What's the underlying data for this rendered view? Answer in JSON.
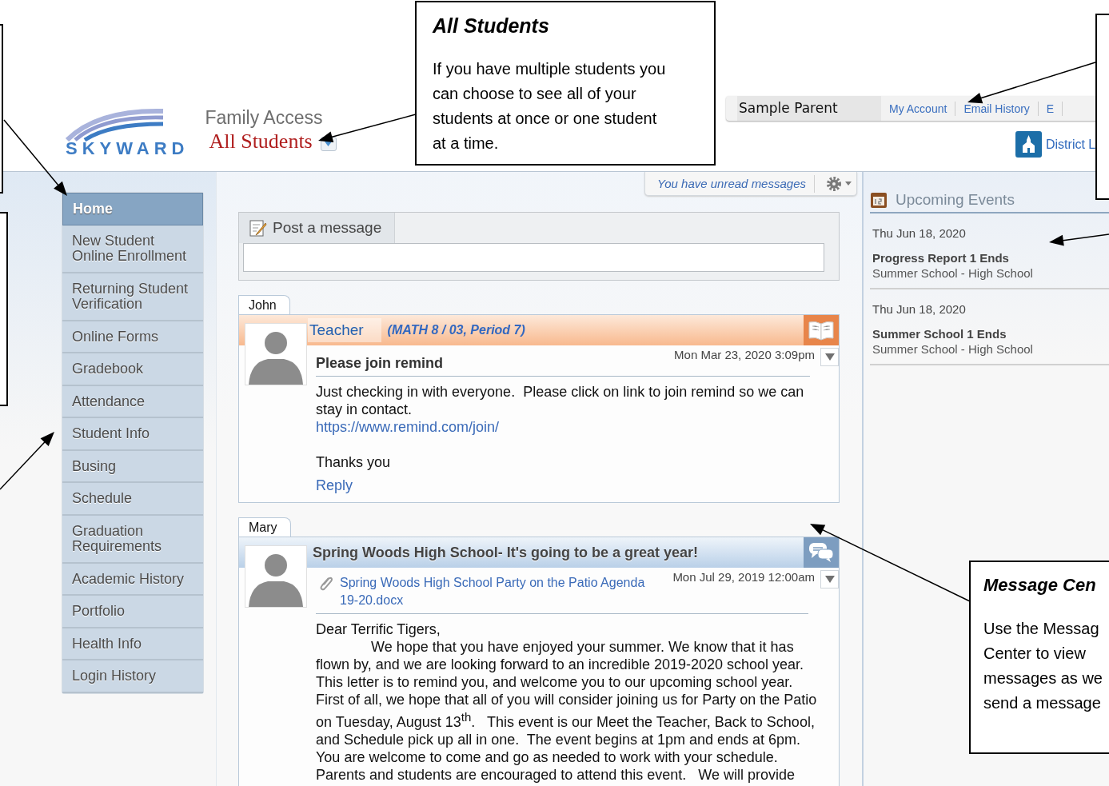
{
  "header": {
    "logo": "SKYWARD",
    "product": "Family Access",
    "student_selector": "All Students",
    "user_name": "Sample Parent",
    "links": [
      "My Account",
      "Email History",
      "E"
    ],
    "district_link": "District L"
  },
  "nav": [
    {
      "label": "Home",
      "selected": true
    },
    {
      "label": "New Student Online Enrollment",
      "selected": false
    },
    {
      "label": "Returning Student Verification",
      "selected": false
    },
    {
      "label": "Online Forms",
      "selected": false
    },
    {
      "label": "Gradebook",
      "selected": false
    },
    {
      "label": "Attendance",
      "selected": false
    },
    {
      "label": "Student Info",
      "selected": false
    },
    {
      "label": "Busing",
      "selected": false
    },
    {
      "label": "Schedule",
      "selected": false
    },
    {
      "label": "Graduation Requirements",
      "selected": false
    },
    {
      "label": "Academic History",
      "selected": false
    },
    {
      "label": "Portfolio",
      "selected": false
    },
    {
      "label": "Health Info",
      "selected": false
    },
    {
      "label": "Login History",
      "selected": false
    }
  ],
  "notice": "You have unread messages",
  "post": {
    "label": "Post a message"
  },
  "messages": [
    {
      "student": "John",
      "kind": "teacher",
      "sender": "Teacher",
      "course": "(MATH 8 / 03, Period 7)",
      "date": "Mon Mar 23, 2020 3:09pm",
      "subject": "Please join remind",
      "body": [
        {
          "kind": "text",
          "text": "Just checking in with everyone.  Please click on link to join remind so we can stay in contact."
        },
        {
          "kind": "link",
          "text": "https://www.remind.com/join/"
        },
        {
          "kind": "gap"
        },
        {
          "kind": "text",
          "text": "Thanks you"
        }
      ],
      "reply": "Reply"
    },
    {
      "student": "Mary",
      "kind": "district",
      "subject": "Spring Woods High School- It's going to be a great year!",
      "date": "Mon Jul 29, 2019 12:00am",
      "attachment": "Spring Woods High School Party on the Patio Agenda 19-20.docx",
      "body": [
        {
          "kind": "text",
          "text": "Dear Terrific Tigers,"
        },
        {
          "kind": "indent",
          "text": "We hope that you have enjoyed your summer. We know that it has flown by, and we are looking forward to an incredible 2019-2020 school year. This letter is to remind you, and welcome you to our upcoming school year. First of all, we hope that all of you will consider joining us for Party on the Patio on Tuesday, August 13$^{th}$.   This event is our Meet the Teacher, Back to School, and Schedule pick up all in one.  The event begins at 1pm and ends at 6pm. You are welcome to come and go as needed to work with your schedule. Parents and students are encouraged to attend this event.   We will provide"
        }
      ]
    }
  ],
  "events": {
    "title": "Upcoming Events",
    "items": [
      {
        "date": "Thu Jun 18, 2020",
        "title": "Progress Report 1 Ends",
        "subtitle": "Summer School - High School"
      },
      {
        "date": "Thu Jun 18, 2020",
        "title": "Summer School 1 Ends",
        "subtitle": "Summer School - High School"
      }
    ]
  },
  "callouts": [
    {
      "title": "All Students",
      "lines": [
        "If you have multiple students you",
        "can choose to see all of your",
        "students at once or one student",
        "at a time."
      ]
    },
    {
      "title": "Message Cen",
      "lines": [
        "Use the Messag",
        "Center to view",
        "messages as we",
        "send a message"
      ]
    }
  ]
}
